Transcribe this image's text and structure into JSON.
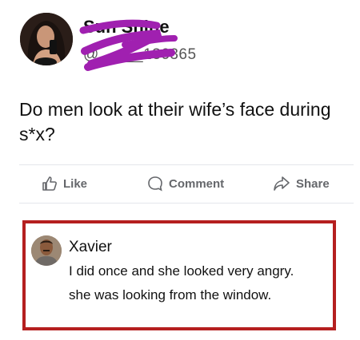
{
  "post": {
    "author": "Sun Shine",
    "handle": "@_____136365",
    "text": "Do men look at their wife’s face during s*x?",
    "scribble_color": "#a020b0"
  },
  "actions": {
    "like": "Like",
    "comment": "Comment",
    "share": "Share"
  },
  "comment": {
    "author": "Xavier",
    "line1": "I did once and she looked very angry.",
    "line2": "she was looking from the window.",
    "highlight_color": "#b51f1f"
  },
  "icons": {
    "like": "thumbs-up-icon",
    "comment": "speech-bubble-icon",
    "share": "share-arrow-icon"
  }
}
